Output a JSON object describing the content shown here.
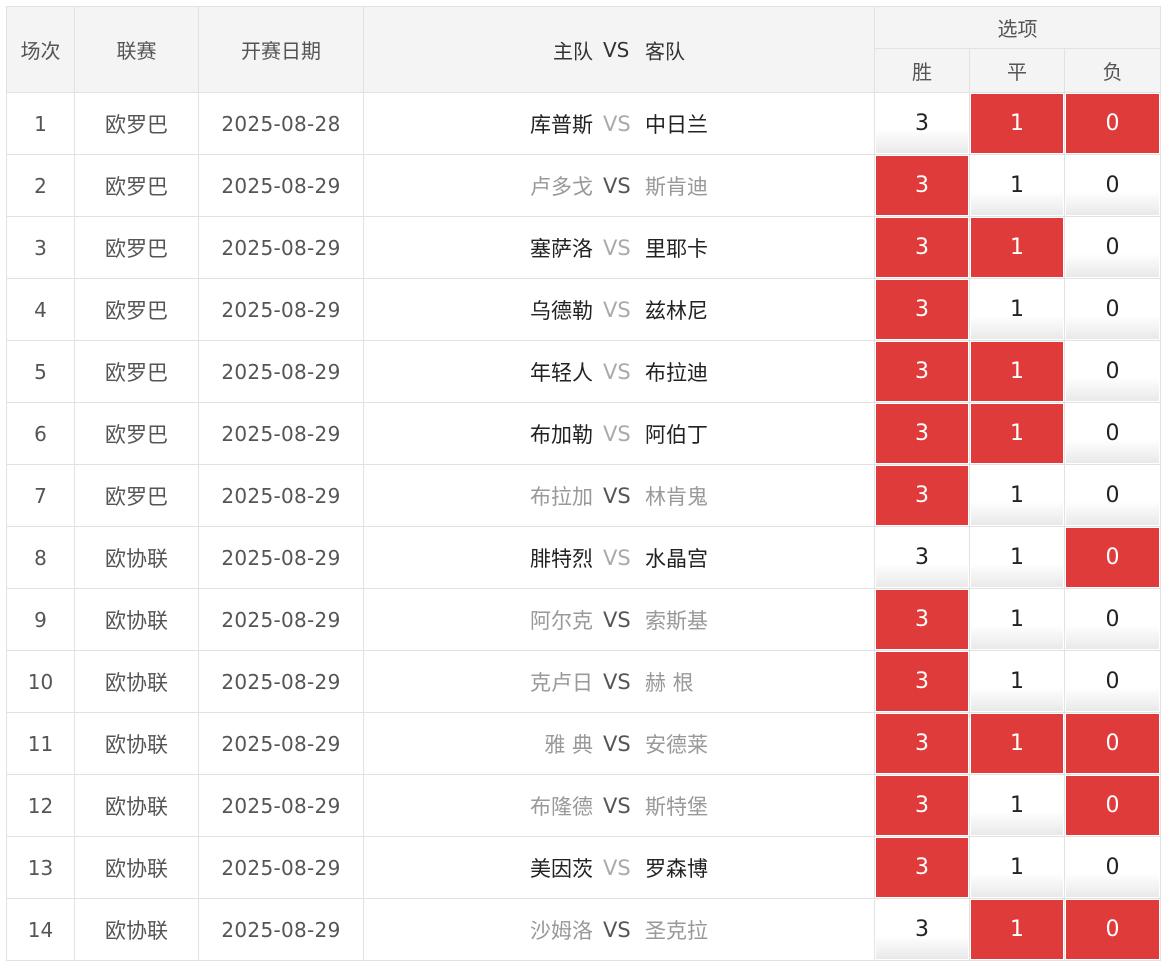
{
  "headers": {
    "index": "场次",
    "league": "联赛",
    "date": "开赛日期",
    "home": "主队",
    "vs": "VS",
    "away": "客队",
    "options": "选项",
    "win": "胜",
    "draw": "平",
    "loss": "负"
  },
  "option_values": {
    "win": "3",
    "draw": "1",
    "loss": "0"
  },
  "colors": {
    "selected": "#e03b3b",
    "header_bg": "#f4f4f4",
    "border": "#e2e2e2"
  },
  "matches": [
    {
      "index": "1",
      "league": "欧罗巴",
      "date": "2025-08-28",
      "home": "库普斯",
      "vs": "VS",
      "away": "中日兰",
      "faded": false,
      "win_selected": false,
      "draw_selected": true,
      "loss_selected": true
    },
    {
      "index": "2",
      "league": "欧罗巴",
      "date": "2025-08-29",
      "home": "卢多戈",
      "vs": "VS",
      "away": "斯肯迪",
      "faded": true,
      "win_selected": true,
      "draw_selected": false,
      "loss_selected": false
    },
    {
      "index": "3",
      "league": "欧罗巴",
      "date": "2025-08-29",
      "home": "塞萨洛",
      "vs": "VS",
      "away": "里耶卡",
      "faded": false,
      "win_selected": true,
      "draw_selected": true,
      "loss_selected": false
    },
    {
      "index": "4",
      "league": "欧罗巴",
      "date": "2025-08-29",
      "home": "乌德勒",
      "vs": "VS",
      "away": "兹林尼",
      "faded": false,
      "win_selected": true,
      "draw_selected": false,
      "loss_selected": false
    },
    {
      "index": "5",
      "league": "欧罗巴",
      "date": "2025-08-29",
      "home": "年轻人",
      "vs": "VS",
      "away": "布拉迪",
      "faded": false,
      "win_selected": true,
      "draw_selected": true,
      "loss_selected": false
    },
    {
      "index": "6",
      "league": "欧罗巴",
      "date": "2025-08-29",
      "home": "布加勒",
      "vs": "VS",
      "away": "阿伯丁",
      "faded": false,
      "win_selected": true,
      "draw_selected": true,
      "loss_selected": false
    },
    {
      "index": "7",
      "league": "欧罗巴",
      "date": "2025-08-29",
      "home": "布拉加",
      "vs": "VS",
      "away": "林肯鬼",
      "faded": true,
      "win_selected": true,
      "draw_selected": false,
      "loss_selected": false
    },
    {
      "index": "8",
      "league": "欧协联",
      "date": "2025-08-29",
      "home": "腓特烈",
      "vs": "VS",
      "away": "水晶宫",
      "faded": false,
      "win_selected": false,
      "draw_selected": false,
      "loss_selected": true
    },
    {
      "index": "9",
      "league": "欧协联",
      "date": "2025-08-29",
      "home": "阿尔克",
      "vs": "VS",
      "away": "索斯基",
      "faded": true,
      "win_selected": true,
      "draw_selected": false,
      "loss_selected": false
    },
    {
      "index": "10",
      "league": "欧协联",
      "date": "2025-08-29",
      "home": "克卢日",
      "vs": "VS",
      "away": "赫 根",
      "faded": true,
      "win_selected": true,
      "draw_selected": false,
      "loss_selected": false
    },
    {
      "index": "11",
      "league": "欧协联",
      "date": "2025-08-29",
      "home": "雅 典",
      "vs": "VS",
      "away": "安德莱",
      "faded": true,
      "win_selected": true,
      "draw_selected": true,
      "loss_selected": true
    },
    {
      "index": "12",
      "league": "欧协联",
      "date": "2025-08-29",
      "home": "布隆德",
      "vs": "VS",
      "away": "斯特堡",
      "faded": true,
      "win_selected": true,
      "draw_selected": false,
      "loss_selected": true
    },
    {
      "index": "13",
      "league": "欧协联",
      "date": "2025-08-29",
      "home": "美因茨",
      "vs": "VS",
      "away": "罗森博",
      "faded": false,
      "win_selected": true,
      "draw_selected": false,
      "loss_selected": false
    },
    {
      "index": "14",
      "league": "欧协联",
      "date": "2025-08-29",
      "home": "沙姆洛",
      "vs": "VS",
      "away": "圣克拉",
      "faded": true,
      "win_selected": false,
      "draw_selected": true,
      "loss_selected": true
    }
  ]
}
